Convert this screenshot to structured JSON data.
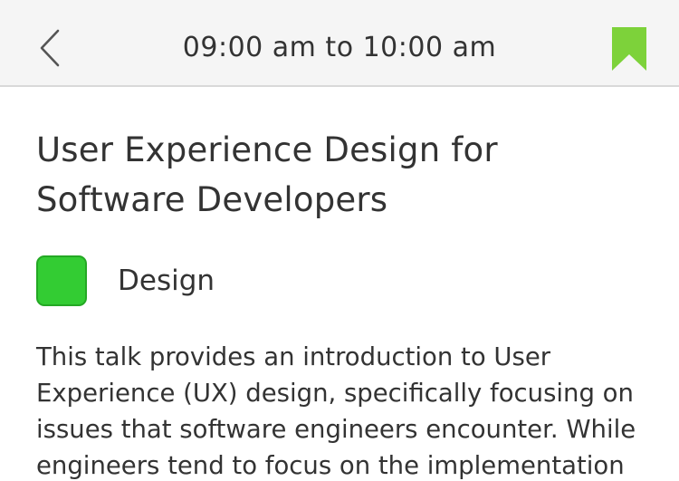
{
  "navbar": {
    "title": "09:00 am to 10:00 am",
    "back_icon": "chevron-left-icon",
    "bookmark_icon": "bookmark-icon",
    "bookmark_color": "#7dd23a",
    "background": "#f5f5f5"
  },
  "session": {
    "title": "User Experience Design for Software Developers",
    "track": {
      "label": "Design",
      "color": "#33cc33"
    },
    "description": "This talk provides an introduction to User Experience (UX) design, specifically focusing on issues that software engineers encounter. While engineers tend to focus on the implementation"
  }
}
